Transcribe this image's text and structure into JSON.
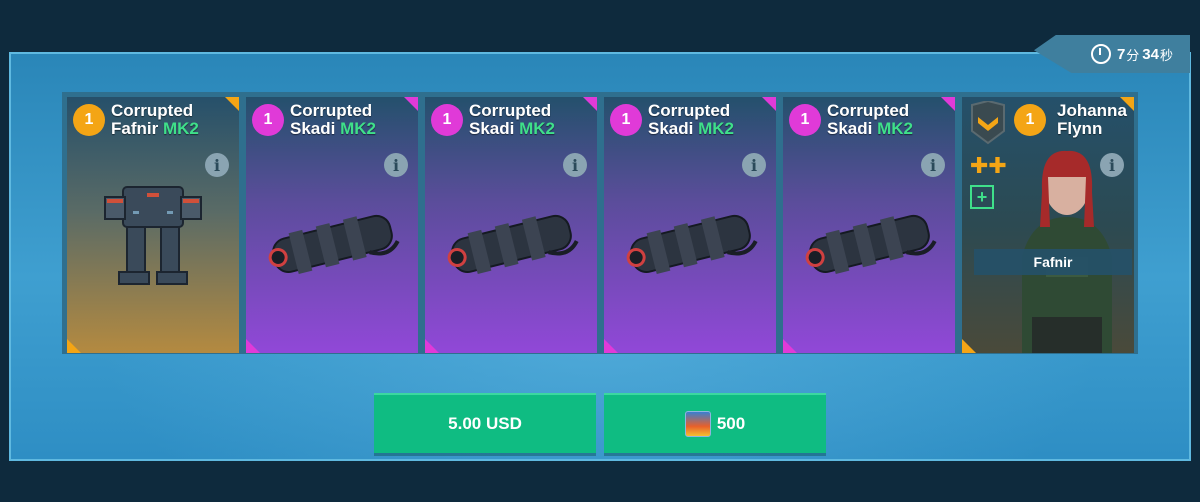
{
  "timer": {
    "minutes": "7",
    "minutes_unit": "分",
    "seconds": "34",
    "seconds_unit": "秒"
  },
  "cards": [
    {
      "level": "1",
      "name_line1": "Corrupted",
      "name_line2": "Fafnir",
      "tier": "MK2",
      "rarity": "gold",
      "kind": "robot"
    },
    {
      "level": "1",
      "name_line1": "Corrupted",
      "name_line2": "Skadi",
      "tier": "MK2",
      "rarity": "pink",
      "kind": "weapon"
    },
    {
      "level": "1",
      "name_line1": "Corrupted",
      "name_line2": "Skadi",
      "tier": "MK2",
      "rarity": "pink",
      "kind": "weapon"
    },
    {
      "level": "1",
      "name_line1": "Corrupted",
      "name_line2": "Skadi",
      "tier": "MK2",
      "rarity": "pink",
      "kind": "weapon"
    },
    {
      "level": "1",
      "name_line1": "Corrupted",
      "name_line2": "Skadi",
      "tier": "MK2",
      "rarity": "pink",
      "kind": "weapon"
    },
    {
      "level": "1",
      "name_line1": "Johanna",
      "name_line2": "Flynn",
      "rarity": "gold",
      "kind": "pilot",
      "robot_tag": "Fafnir"
    }
  ],
  "buttons": {
    "price_usd": "5.00 USD",
    "price_gold": "500"
  },
  "colors": {
    "accent_green": "#0fbc82",
    "rarity_gold": "#f4a515",
    "rarity_pink": "#e03ad8",
    "mk2_green": "#3fe08a"
  }
}
